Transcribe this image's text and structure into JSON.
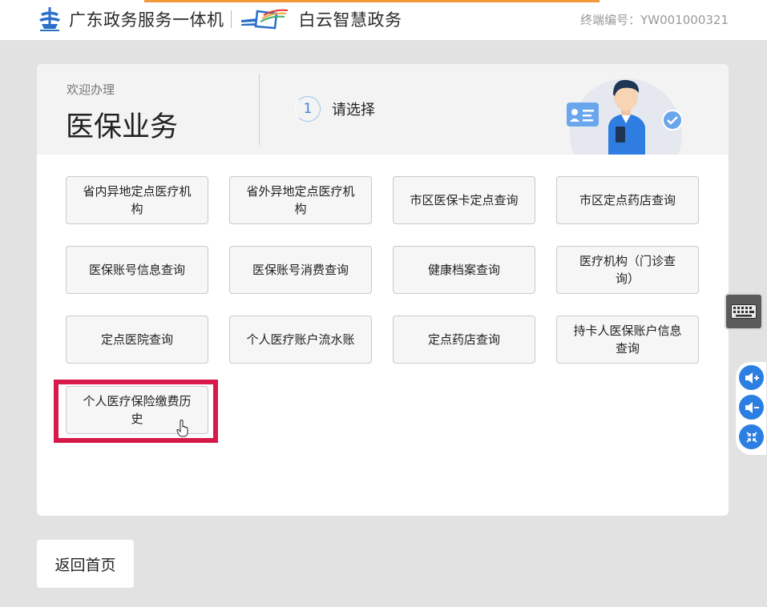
{
  "header": {
    "brand_name": "广东政务服务一体机",
    "sub_brand": "白云智慧政务",
    "terminal_id": "终端编号：YW001000321"
  },
  "panel": {
    "welcome": "欢迎办理",
    "title": "医保业务",
    "step_number": "1",
    "step_label": "请选择"
  },
  "services": [
    "省内异地定点医疗机构",
    "省外异地定点医疗机构",
    "市区医保卡定点查询",
    "市区定点药店查询",
    "医保账号信息查询",
    "医保账号消费查询",
    "健康档案查询",
    "医疗机构（门诊查询）",
    "定点医院查询",
    "个人医疗账户流水账",
    "定点药店查询",
    "持卡人医保账户信息查询",
    "个人医疗保险缴费历史"
  ],
  "footer": {
    "back_label": "返回首页"
  },
  "colors": {
    "accent_orange": "#f29a3a",
    "highlight_red": "#d7194a",
    "tool_blue": "#2c7fe2"
  },
  "icons": [
    "government-emblem-icon",
    "baiyun-logo-icon",
    "keyboard-icon",
    "volume-up-icon",
    "volume-down-icon",
    "collapse-icon",
    "pointer-hand-icon"
  ]
}
